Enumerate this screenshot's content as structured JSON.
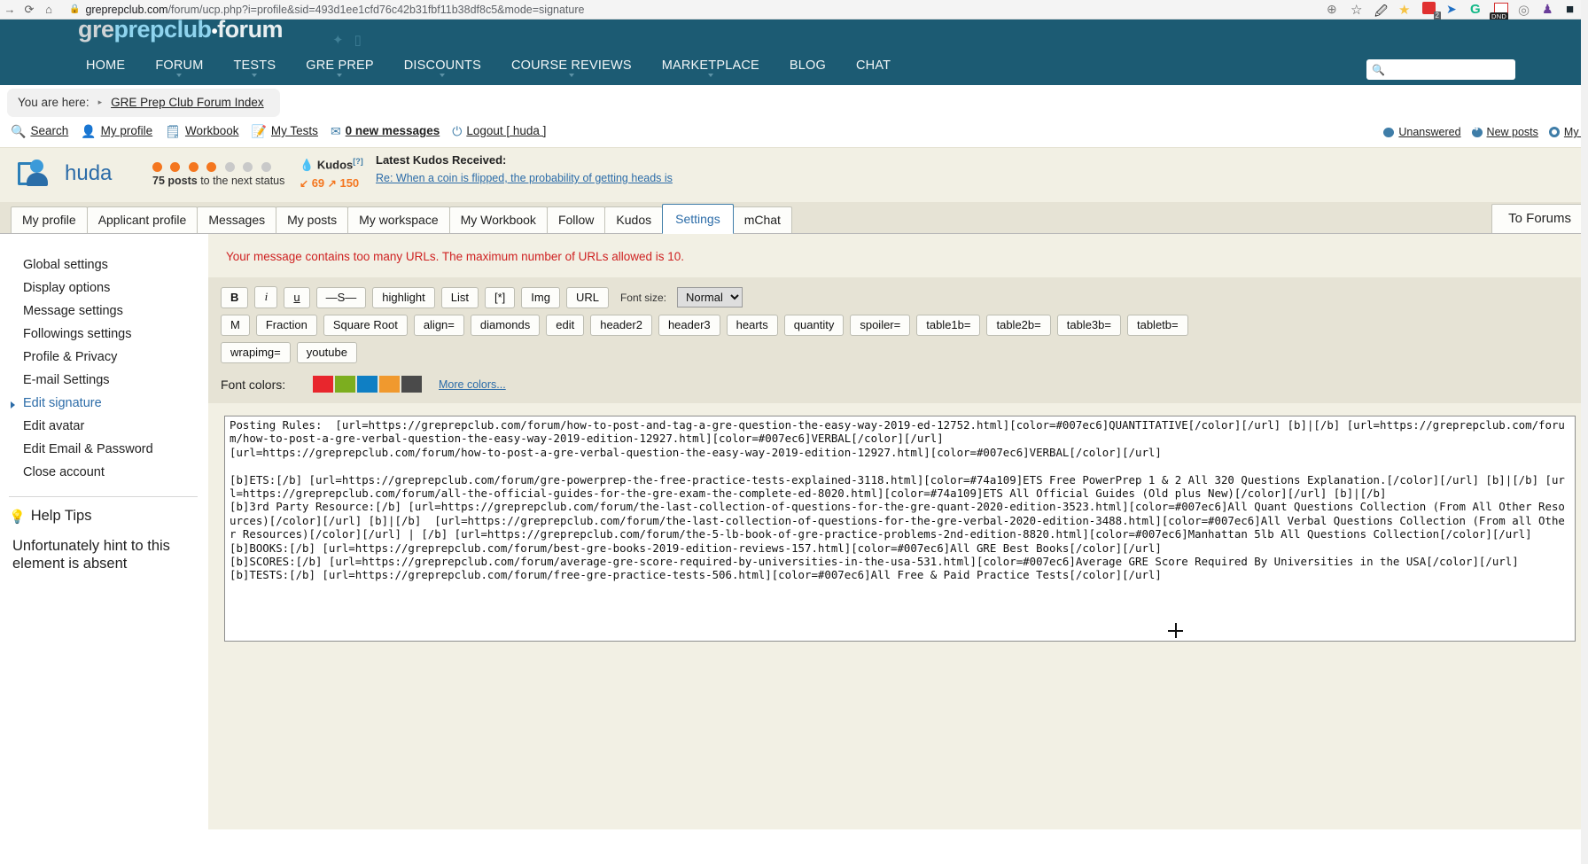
{
  "browser": {
    "url_host": "greprepclub.com",
    "url_path": "/forum/ucp.php?i=profile&sid=493d1ee1cfd76c42b31fbf11b38df8c5&mode=signature",
    "nav": {
      "forward": "→",
      "reload": "⟳",
      "home": "⌂"
    },
    "lock": "🔒",
    "extensions": [
      {
        "name": "zoom-icon",
        "glyph": "⊕"
      },
      {
        "name": "bookmark-star-icon",
        "glyph": "☆"
      },
      {
        "name": "note-edit-icon",
        "glyph": "✎"
      },
      {
        "name": "favorites-star-icon",
        "glyph": "★"
      },
      {
        "name": "red-extension-icon",
        "badge": "2"
      },
      {
        "name": "blue-paper-plane-icon",
        "glyph": "➤"
      },
      {
        "name": "grammarly-icon",
        "glyph": "G"
      },
      {
        "name": "mail-checker-icon",
        "glyph": "✉",
        "label": "DND"
      },
      {
        "name": "circle-loader-icon",
        "glyph": "◎"
      },
      {
        "name": "purple-bag-icon",
        "glyph": "👜"
      },
      {
        "name": "dark-square-icon",
        "glyph": "■"
      }
    ]
  },
  "header": {
    "logo": {
      "part1": "gre",
      "part2": "prep",
      "part3": "club",
      "dot": "•",
      "part4": "forum"
    },
    "social": [
      "twitter-icon",
      "facebook-icon"
    ],
    "nav_items": [
      {
        "label": "HOME",
        "caret": false
      },
      {
        "label": "FORUM",
        "caret": true
      },
      {
        "label": "TESTS",
        "caret": true
      },
      {
        "label": "GRE PREP",
        "caret": true
      },
      {
        "label": "DISCOUNTS",
        "caret": true
      },
      {
        "label": "COURSE REVIEWS",
        "caret": true
      },
      {
        "label": "MARKETPLACE",
        "caret": true
      },
      {
        "label": "BLOG",
        "caret": false
      },
      {
        "label": "CHAT",
        "caret": false
      }
    ],
    "search_placeholder": ""
  },
  "breadcrumb": {
    "prefix": "You are here:",
    "arrow": "▸",
    "link": "GRE Prep Club Forum Index"
  },
  "quicklinks": {
    "left": [
      {
        "icon": "search-icon",
        "glyph": "🔍",
        "label": "Search"
      },
      {
        "icon": "user-icon",
        "glyph": "👤",
        "label": "My profile"
      },
      {
        "icon": "workbook-icon",
        "glyph": "📋",
        "label": "Workbook"
      },
      {
        "icon": "tests-icon",
        "glyph": "📝",
        "label": "My Tests"
      },
      {
        "icon": "envelope-icon",
        "glyph": "✉",
        "label": "0 new messages",
        "bold_prefix": "0"
      },
      {
        "icon": "power-icon",
        "glyph": "⏻",
        "label": "Logout [ huda ]"
      }
    ],
    "right": [
      {
        "icon": "unanswered-icon",
        "label": "Unanswered"
      },
      {
        "icon": "new-posts-icon",
        "label": "New posts"
      },
      {
        "icon": "my-posts-icon",
        "label": "My p"
      }
    ]
  },
  "user": {
    "name": "huda",
    "status_dots_on": 4,
    "status_dots_off": 3,
    "status_count": "75 posts",
    "status_suffix": " to the next status",
    "kudos_label": "Kudos",
    "kudos_help": "[?]",
    "kudos_given": "69",
    "kudos_received": "150",
    "latest_kudos_label": "Latest Kudos Received:",
    "latest_kudos_link": "Re: When a coin is flipped, the probability of getting heads is"
  },
  "tabs": [
    {
      "label": "My profile",
      "active": false
    },
    {
      "label": "Applicant profile",
      "active": false
    },
    {
      "label": "Messages",
      "active": false
    },
    {
      "label": "My posts",
      "active": false
    },
    {
      "label": "My workspace",
      "active": false
    },
    {
      "label": "My Workbook",
      "active": false
    },
    {
      "label": "Follow",
      "active": false
    },
    {
      "label": "Kudos",
      "active": false
    },
    {
      "label": "Settings",
      "active": true
    },
    {
      "label": "mChat",
      "active": false
    }
  ],
  "to_forums": "To Forums",
  "sidebar": {
    "items": [
      {
        "label": "Global settings",
        "active": false
      },
      {
        "label": "Display options",
        "active": false
      },
      {
        "label": "Message settings",
        "active": false
      },
      {
        "label": "Followings settings",
        "active": false
      },
      {
        "label": "Profile & Privacy",
        "active": false
      },
      {
        "label": "E-mail Settings",
        "active": false
      },
      {
        "label": "Edit signature",
        "active": true
      },
      {
        "label": "Edit avatar",
        "active": false
      },
      {
        "label": "Edit Email & Password",
        "active": false
      },
      {
        "label": "Close account",
        "active": false
      }
    ],
    "help_title": "Help Tips",
    "help_text": "Unfortunately hint to this element is absent"
  },
  "main": {
    "error": "Your message contains too many URLs. The maximum number of URLs allowed is 10.",
    "toolbar_row1": [
      "B",
      "i",
      "u",
      "—S—",
      "highlight",
      "List",
      "[*]",
      "Img",
      "URL"
    ],
    "fontsize_label": "Font size:",
    "fontsize_value": "Normal",
    "toolbar_row2": [
      "M",
      "Fraction",
      "Square Root",
      "align=",
      "diamonds",
      "edit",
      "header2",
      "header3",
      "hearts",
      "quantity",
      "spoiler=",
      "table1b=",
      "table2b=",
      "table3b=",
      "tabletb="
    ],
    "toolbar_row3": [
      "wrapimg=",
      "youtube"
    ],
    "font_colors_label": "Font colors:",
    "font_colors": [
      "#e8262d",
      "#7cae1f",
      "#0f7fc4",
      "#f0992e",
      "#4a4a4a"
    ],
    "more_colors": "More colors...",
    "signature_text": "Posting Rules:  [url=https://greprepclub.com/forum/how-to-post-and-tag-a-gre-question-the-easy-way-2019-ed-12752.html][color=#007ec6]QUANTITATIVE[/color][/url] [b]|[/b] [url=https://greprepclub.com/forum/how-to-post-a-gre-verbal-question-the-easy-way-2019-edition-12927.html][color=#007ec6]VERBAL[/color][/url]\n[url=https://greprepclub.com/forum/how-to-post-a-gre-verbal-question-the-easy-way-2019-edition-12927.html][color=#007ec6]VERBAL[/color][/url]\n\n[b]ETS:[/b] [url=https://greprepclub.com/forum/gre-powerprep-the-free-practice-tests-explained-3118.html][color=#74a109]ETS Free PowerPrep 1 & 2 All 320 Questions Explanation.[/color][/url] [b]|[/b] [url=https://greprepclub.com/forum/all-the-official-guides-for-the-gre-exam-the-complete-ed-8020.html][color=#74a109]ETS All Official Guides (Old plus New)[/color][/url] [b]|[/b]\n[b]3rd Party Resource:[/b] [url=https://greprepclub.com/forum/the-last-collection-of-questions-for-the-gre-quant-2020-edition-3523.html][color=#007ec6]All Quant Questions Collection (From All Other Resources)[/color][/url] [b]|[/b]  [url=https://greprepclub.com/forum/the-last-collection-of-questions-for-the-gre-verbal-2020-edition-3488.html][color=#007ec6]All Verbal Questions Collection (From all Other Resources)[/color][/url] | [/b] [url=https://greprepclub.com/forum/the-5-lb-book-of-gre-practice-problems-2nd-edition-8820.html][color=#007ec6]Manhattan 5lb All Questions Collection[/color][/url]\n[b]BOOKS:[/b] [url=https://greprepclub.com/forum/best-gre-books-2019-edition-reviews-157.html][color=#007ec6]All GRE Best Books[/color][/url]\n[b]SCORES:[/b] [url=https://greprepclub.com/forum/average-gre-score-required-by-universities-in-the-usa-531.html][color=#007ec6]Average GRE Score Required By Universities in the USA[/color][/url]\n[b]TESTS:[/b] [url=https://greprepclub.com/forum/free-gre-practice-tests-506.html][color=#007ec6]All Free & Paid Practice Tests[/color][/url]"
  }
}
